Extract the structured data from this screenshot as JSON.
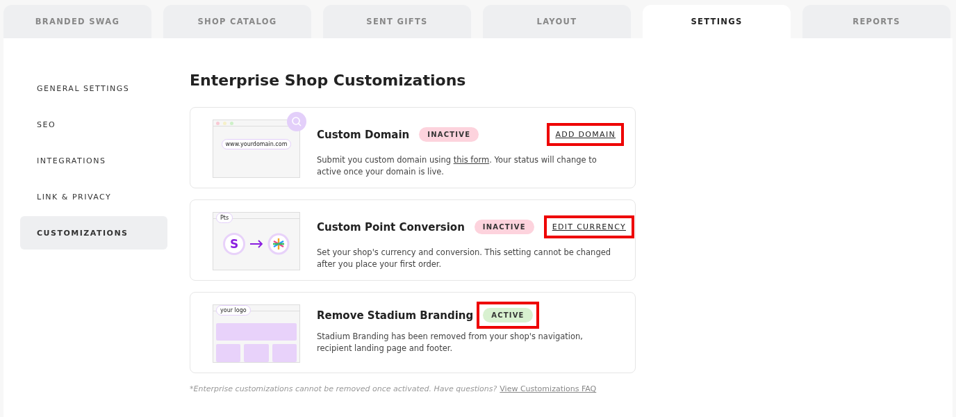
{
  "tabs": [
    {
      "label": "BRANDED SWAG",
      "selected": false
    },
    {
      "label": "SHOP CATALOG",
      "selected": false
    },
    {
      "label": "SENT GIFTS",
      "selected": false
    },
    {
      "label": "LAYOUT",
      "selected": false
    },
    {
      "label": "SETTINGS",
      "selected": true
    },
    {
      "label": "REPORTS",
      "selected": false
    }
  ],
  "sidebar": {
    "items": [
      {
        "label": "GENERAL SETTINGS",
        "selected": false
      },
      {
        "label": "SEO",
        "selected": false
      },
      {
        "label": "INTEGRATIONS",
        "selected": false
      },
      {
        "label": "LINK & PRIVACY",
        "selected": false
      },
      {
        "label": "CUSTOMIZATIONS",
        "selected": true
      }
    ]
  },
  "heading": "Enterprise Shop Customizations",
  "cards": [
    {
      "illustration": {
        "kind": "domain",
        "field_text": "www.yourdomain.com"
      },
      "title": "Custom Domain",
      "status": {
        "label": "INACTIVE",
        "kind": "inactive",
        "highlighted": false
      },
      "action": {
        "label": "ADD DOMAIN",
        "highlighted": true
      },
      "description": [
        {
          "kind": "text",
          "text": "Submit you custom domain using "
        },
        {
          "kind": "link",
          "text": "this form"
        },
        {
          "kind": "text",
          "text": ". Your status will change to active once your domain is live."
        }
      ]
    },
    {
      "illustration": {
        "kind": "conversion",
        "tab_text": "Pts",
        "coin_text": "S"
      },
      "title": "Custom Point Conversion",
      "status": {
        "label": "INACTIVE",
        "kind": "inactive",
        "highlighted": false
      },
      "action": {
        "label": "EDIT CURRENCY",
        "highlighted": true
      },
      "description": [
        {
          "kind": "text",
          "text": "Set your shop's currency and conversion. This setting cannot be changed after you place your first order."
        }
      ]
    },
    {
      "illustration": {
        "kind": "branding",
        "tab_text": "your logo"
      },
      "title": "Remove Stadium Branding",
      "status": {
        "label": "ACTIVE",
        "kind": "active",
        "highlighted": true
      },
      "description": [
        {
          "kind": "text",
          "text": "Stadium Branding has been removed from your shop's navigation, recipient landing page and footer."
        }
      ]
    }
  ],
  "footnote": {
    "text": "*Enterprise customizations cannot be removed once activated. Have questions?",
    "link": "View Customizations FAQ"
  }
}
